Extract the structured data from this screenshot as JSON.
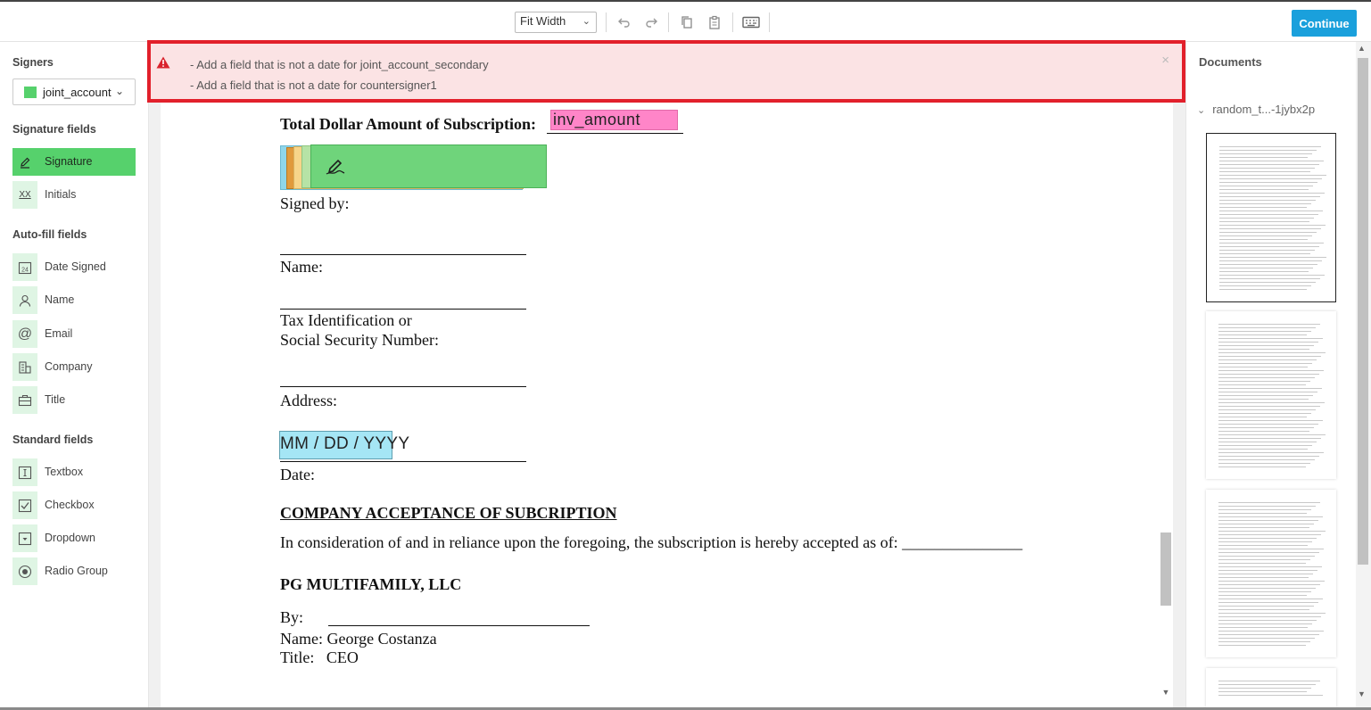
{
  "toolbar": {
    "zoom": "Fit Width",
    "continue_label": "Continue"
  },
  "left": {
    "signers_title": "Signers",
    "signer": "joint_account",
    "signature_fields_title": "Signature fields",
    "signature_fields": [
      "Signature",
      "Initials"
    ],
    "initials_icon_text": "XX",
    "autofill_title": "Auto-fill fields",
    "autofill_fields": [
      "Date Signed",
      "Name",
      "Email",
      "Company",
      "Title"
    ],
    "date_icon_text": "24",
    "standard_title": "Standard fields",
    "standard_fields": [
      "Textbox",
      "Checkbox",
      "Dropdown",
      "Radio Group"
    ]
  },
  "errors": [
    "- Add a field that is not a date for joint_account_secondary",
    "- Add a field that is not a date for countersigner1"
  ],
  "error_close": "×",
  "document": {
    "subscription_label": "Total Dollar Amount of Subscription:",
    "amount_field": "inv_amount",
    "signed_by": "Signed by:",
    "name_label": "Name:",
    "tax_line1": "Tax Identification or",
    "tax_line2": "Social Security Number:",
    "address_label": "Address:",
    "date_placeholder": "MM / DD / YYYY",
    "date_label": "Date:",
    "acceptance_heading": "COMPANY ACCEPTANCE OF SUBCRIPTION",
    "acceptance_text": "In consideration of and in reliance upon the foregoing, the subscription is hereby accepted as of: _______________",
    "company_name": "PG MULTIFAMILY, LLC",
    "by_label": "By:",
    "name_line": "Name: George Costanza",
    "title_line": "Title:   CEO"
  },
  "right": {
    "title": "Documents",
    "doc_name": "random_t...-1jybx2p"
  },
  "colors": {
    "accent": "#1aa0dc",
    "signer": "#56d16c",
    "error_border": "#e2202b",
    "amount_field": "#ff85c8",
    "date_field": "#a5e6f5"
  }
}
